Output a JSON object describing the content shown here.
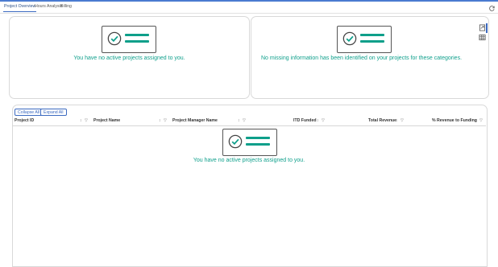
{
  "tabs": [
    {
      "label": "Project Overview",
      "active": true
    },
    {
      "label": "Hours Analysis",
      "active": false
    },
    {
      "label": "Billing",
      "active": false
    }
  ],
  "cards": {
    "active_projects_message": "You have no active projects assigned to you.",
    "missing_info_message": "No missing information has been identified on your projects for these categories."
  },
  "table": {
    "collapse_label": "Collapse All",
    "expand_label": "Expand All",
    "columns": [
      {
        "label": "Project ID"
      },
      {
        "label": "Project Name"
      },
      {
        "label": "Project Manager Name"
      },
      {
        "label": "ITD Funded"
      },
      {
        "label": "Total Revenue"
      },
      {
        "label": "% Revenue to Funding"
      }
    ],
    "empty_message": "You have no active projects assigned to you."
  },
  "icons": {
    "refresh": "refresh-icon",
    "sort": "sort-icon",
    "filter": "filter-icon",
    "export": "export-icon",
    "grid": "grid-icon"
  },
  "colors": {
    "accent": "#3c6ac0",
    "success": "#10a08c",
    "bar": "#0e9f8a"
  }
}
